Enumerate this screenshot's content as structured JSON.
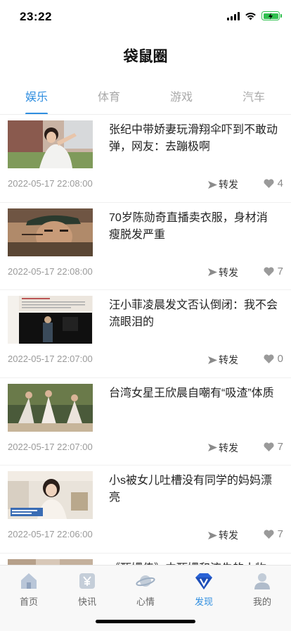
{
  "status": {
    "time": "23:22"
  },
  "header": {
    "title": "袋鼠圈"
  },
  "tabs": [
    {
      "label": "娱乐",
      "active": true
    },
    {
      "label": "体育",
      "active": false
    },
    {
      "label": "游戏",
      "active": false
    },
    {
      "label": "汽车",
      "active": false
    }
  ],
  "articles": [
    {
      "title": "张纪中带娇妻玩滑翔伞吓到不敢动弹，网友：去蹦极啊",
      "date": "2022-05-17 22:08:00",
      "share_label": "转发",
      "likes": "4"
    },
    {
      "title": "70岁陈勋奇直播卖衣服，身材消瘦脱发严重",
      "date": "2022-05-17 22:08:00",
      "share_label": "转发",
      "likes": "7"
    },
    {
      "title": "汪小菲凌晨发文否认倒闭：我不会流眼泪的",
      "date": "2022-05-17 22:07:00",
      "share_label": "转发",
      "likes": "0"
    },
    {
      "title": "台湾女星王欣晨自嘲有“吸渣”体质",
      "date": "2022-05-17 22:07:00",
      "share_label": "转发",
      "likes": "7"
    },
    {
      "title": "小s被女儿吐槽没有同学的妈妈漂亮",
      "date": "2022-05-17 22:06:00",
      "share_label": "转发",
      "likes": "7"
    },
    {
      "title": "《甄嬛传》中甄嬛和流朱的小物…",
      "date": "",
      "share_label": "",
      "likes": ""
    }
  ],
  "tabbar": [
    {
      "label": "首页",
      "icon": "home-icon",
      "active": false
    },
    {
      "label": "快讯",
      "icon": "yen-icon",
      "active": false
    },
    {
      "label": "心情",
      "icon": "planet-icon",
      "active": false
    },
    {
      "label": "发现",
      "icon": "diamond-v-icon",
      "active": true
    },
    {
      "label": "我的",
      "icon": "person-icon",
      "active": false
    }
  ],
  "colors": {
    "accent": "#2f8ee0",
    "battery": "#30c04f",
    "inactive_tab": "#a9a9a9"
  }
}
